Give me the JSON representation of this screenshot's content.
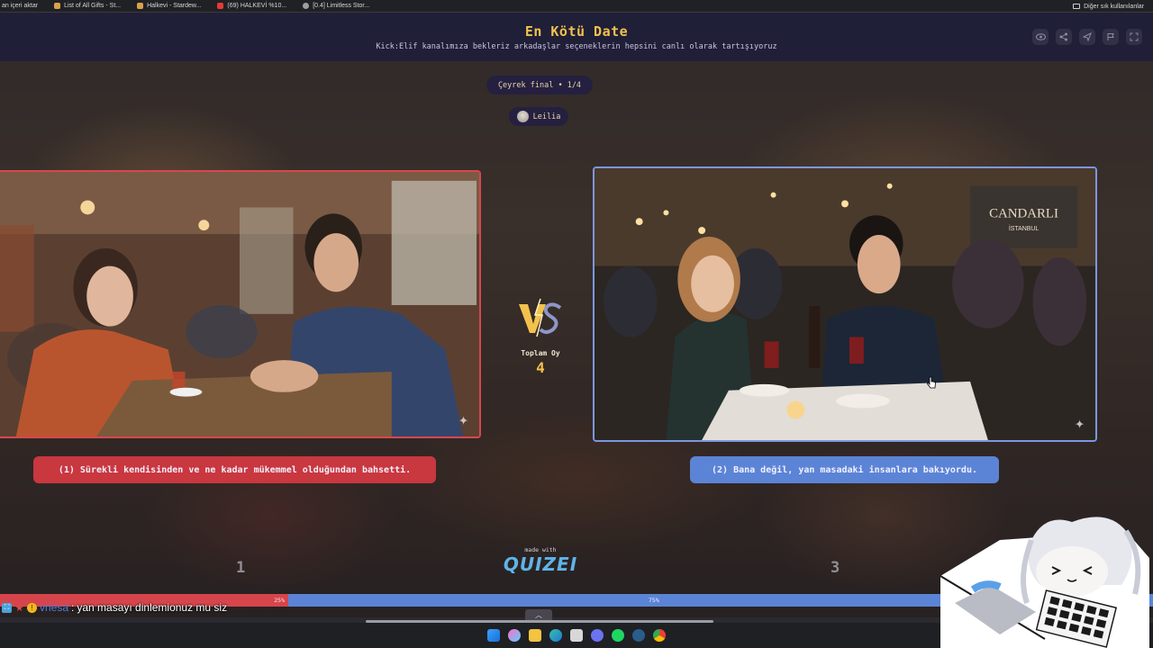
{
  "browser": {
    "bookmarks": [
      {
        "label": "an içeri aktar",
        "icon_color": "#8a8a8a"
      },
      {
        "label": "List of All Gifts - St...",
        "icon_color": "#d9a14a"
      },
      {
        "label": "Halkevi - Stardew...",
        "icon_color": "#d9a14a"
      },
      {
        "label": "(69) HALKEVİ %10...",
        "icon_color": "#e53935"
      },
      {
        "label": "[0.4] Limitless Stor...",
        "icon_color": "#9e9e9e"
      }
    ],
    "right_bookmark": "Diğer sık kullanılanlar"
  },
  "header": {
    "title": "En Kötü Date",
    "subtitle": "Kick:Elif kanalımıza bekleriz arkadaşlar seçeneklerin hepsini canlı olarak tartışıyoruz",
    "icons": [
      "eye-icon",
      "share-icon",
      "send-icon",
      "flag-icon",
      "fullscreen-icon"
    ]
  },
  "round": {
    "label": "Çeyrek final • 1/4"
  },
  "user": {
    "name": "Leilia"
  },
  "options": {
    "left": {
      "label": "(1) Sürekli kendisinden ve ne kadar mükemmel olduğundan bahsetti.",
      "count": "1",
      "accent": "#d7474f"
    },
    "right": {
      "label": "(2) Bana değil, yan masadaki insanlara bakıyordu.",
      "count": "3",
      "accent": "#7d97df"
    }
  },
  "center": {
    "total_label": "Toplam Oy",
    "total_value": "4"
  },
  "vote_bar": {
    "left_percent": "25%",
    "right_percent": "75%",
    "left_fraction": 0.25,
    "right_fraction": 0.75
  },
  "footer": {
    "made_with": "made with",
    "brand": "QUIZEI"
  },
  "chat": {
    "username": "vriesa",
    "separator": ":",
    "message": "yan masayı dinlemionuz mu siz"
  },
  "taskbar": {
    "icons": [
      "windows-icon",
      "copilot-icon",
      "file-explorer-icon",
      "edge-icon",
      "store-icon",
      "discord-icon",
      "spotify-icon",
      "steam-icon",
      "chrome-icon"
    ]
  }
}
